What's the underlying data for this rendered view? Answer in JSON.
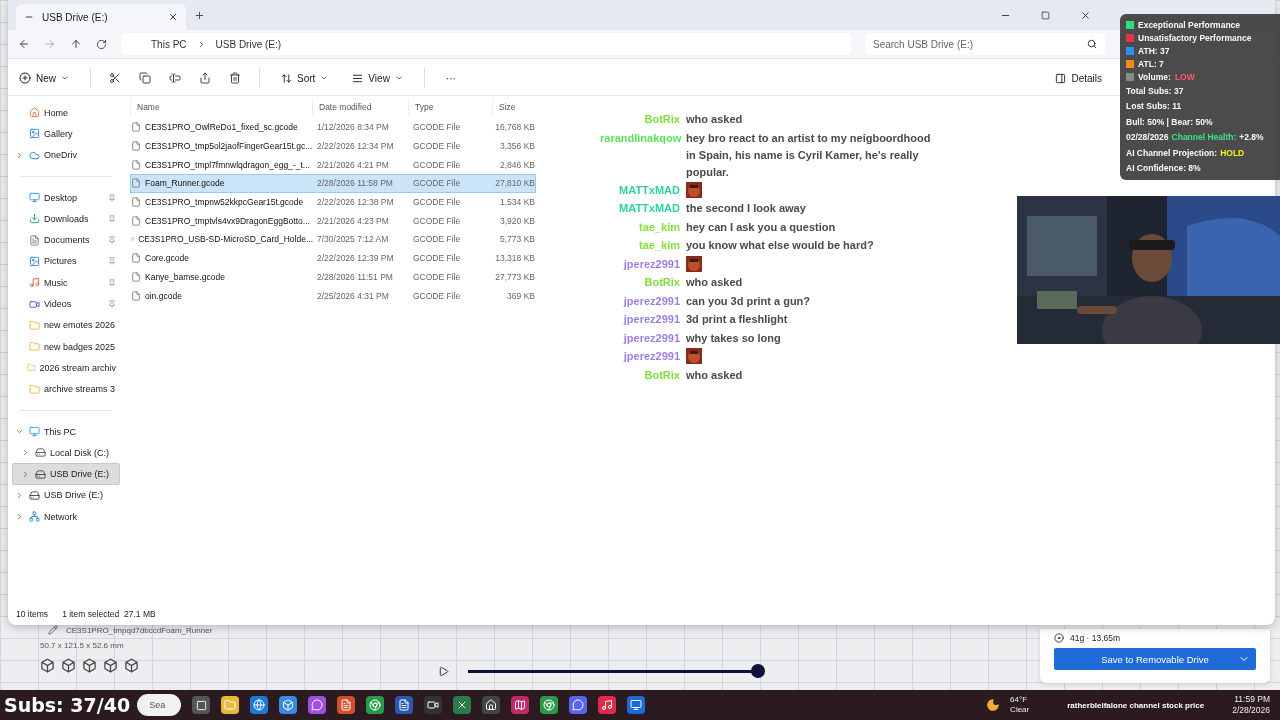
{
  "explorer": {
    "tab_title": "USB Drive (E:)",
    "breadcrumb": [
      "This PC",
      "USB Drive (E:)"
    ],
    "search": {
      "placeholder": "Search USB Drive (E:)"
    },
    "toolbar": {
      "new": "New",
      "sort": "Sort",
      "view": "View",
      "more": "···",
      "details": "Details"
    },
    "sidebar": [
      {
        "items": [
          {
            "label": "Home",
            "selected": false
          },
          {
            "label": "Gallery",
            "selected": false
          },
          {
            "label": "OneDriv",
            "selected": false,
            "expanded": false
          }
        ]
      },
      {
        "items": [
          {
            "label": "Desktop",
            "pinned": true,
            "selected": false
          },
          {
            "label": "Downloads",
            "pinned": true,
            "selected": false
          },
          {
            "label": "Documents",
            "pinned": true,
            "selected": false
          },
          {
            "label": "Pictures",
            "pinned": true,
            "selected": false
          },
          {
            "label": "Music",
            "pinned": true,
            "selected": false
          },
          {
            "label": "Videos",
            "pinned": true,
            "selected": false
          },
          {
            "label": "new emotes 2026",
            "selected": false
          },
          {
            "label": "new badges 2025",
            "selected": false
          },
          {
            "label": "2026 stream archiv",
            "selected": false
          },
          {
            "label": "archive streams 3",
            "selected": false
          }
        ]
      },
      {
        "items": [
          {
            "label": "This PC",
            "selected": false,
            "expanded": true,
            "children": [
              {
                "label": "Local Disk (C:)",
                "selected": false,
                "expanded": false
              },
              {
                "label": "USB Drive (E:)",
                "selected": true,
                "expanded": false
              }
            ]
          },
          {
            "label": "USB Drive (E:)",
            "selected": false,
            "expanded": false
          },
          {
            "label": "Network",
            "selected": false,
            "expanded": false
          }
        ]
      }
    ],
    "columns": [
      "Name",
      "Date modified",
      "Type",
      "Size"
    ],
    "rows": [
      {
        "name": "CE3S1PRO_OwlReDo1_fixed_sc.gcode",
        "date": "1/12/2026 8:34 PM",
        "type": "GCODE File",
        "size": "16,768 KB",
        "selected": false
      },
      {
        "name": "CE3S1PRO_tmp5ol2jaofFingerGear15t.gc...",
        "date": "2/22/2026 12:34 PM",
        "type": "GCODE File",
        "size": "3,356 KB",
        "selected": false
      },
      {
        "name": "CE3S1PRO_tmpl7fmnwlqdragon_egg_-_t...",
        "date": "2/21/2026 4:21 PM",
        "type": "GCODE File",
        "size": "2,846 KB",
        "selected": false
      },
      {
        "name": "Foam_Runner.gcode",
        "date": "2/28/2026 11:58 PM",
        "type": "GCODE File",
        "size": "27,810 KB",
        "selected": true
      },
      {
        "name": "CE3S1PRO_tmpnw52kkpcGear15t.gcode",
        "date": "2/22/2026 12:38 PM",
        "type": "GCODE File",
        "size": "1,534 KB",
        "selected": false
      },
      {
        "name": "CE3S1PRO_tmptvls4vx9DragonEggBotto...",
        "date": "2/21/2026 4:23 PM",
        "type": "GCODE File",
        "size": "3,920 KB",
        "selected": false
      },
      {
        "name": "CE3S1PRO_USB-SD-MicroSD_Card_Holde...",
        "date": "7/30/2025 7:12 AM",
        "type": "GCODE File",
        "size": "5,773 KB",
        "selected": false
      },
      {
        "name": "Core.gcode",
        "date": "2/22/2026 12:39 PM",
        "type": "GCODE File",
        "size": "13,318 KB",
        "selected": false
      },
      {
        "name": "Kanye_bamse.gcode",
        "date": "2/28/2026 11:51 PM",
        "type": "GCODE File",
        "size": "27,773 KB",
        "selected": false
      },
      {
        "name": "oin.gcode",
        "date": "2/25/2026 4:31 PM",
        "type": "GCODE File",
        "size": "369 KB",
        "selected": false
      }
    ],
    "status": {
      "count": "10 items",
      "selection": "1 item selected  27.1 MB"
    }
  },
  "slicer": {
    "object_name": "CE3S1PRO_tmpqd7dbccdFoam_Runner",
    "dimensions": "50.7 x 121.5 x 52.6 mm",
    "estimate": "41g · 13.65m",
    "save_button": "Save to Removable Drive",
    "layer_slider": {
      "level": 1
    }
  },
  "chat": [
    {
      "kind": "message",
      "user": "BotRix",
      "color": "#7fdc3c",
      "message": "who asked"
    },
    {
      "kind": "message",
      "user": "rarandlinakqow",
      "color": "#5de05a",
      "message": "hey bro react to an artist to my neigboordhood in Spain, his name is Cyril Kamer, he's really popular."
    },
    {
      "kind": "emote",
      "user": "MATTxMAD",
      "color": "#2ed39a"
    },
    {
      "kind": "message",
      "user": "MATTxMAD",
      "color": "#2ed39a",
      "message": "the second I look away"
    },
    {
      "kind": "message",
      "user": "tae_kim",
      "color": "#86e03c",
      "message": "hey can I ask you a question"
    },
    {
      "kind": "message",
      "user": "tae_kim",
      "color": "#86e03c",
      "message": "you know what else would be hard?"
    },
    {
      "kind": "emote",
      "user": "jperez2991",
      "color": "#9c7fe2"
    },
    {
      "kind": "message",
      "user": "BotRix",
      "color": "#7fdc3c",
      "message": "who asked"
    },
    {
      "kind": "message",
      "user": "jperez2991",
      "color": "#9c7fe2",
      "message": "can you 3d print a gun?"
    },
    {
      "kind": "message",
      "user": "jperez2991",
      "color": "#9c7fe2",
      "message": "3d print a fleshlight"
    },
    {
      "kind": "message",
      "user": "jperez2991",
      "color": "#9c7fe2",
      "message": "why takes so long"
    },
    {
      "kind": "emote",
      "user": "jperez2991",
      "color": "#9c7fe2"
    },
    {
      "kind": "message",
      "user": "BotRix",
      "color": "#7fdc3c",
      "message": "who asked"
    }
  ],
  "stats": {
    "legend": [
      {
        "color": "#2fe07a",
        "parts": [
          {
            "text": "Exceptional Performance"
          }
        ]
      },
      {
        "color": "#e8334a",
        "parts": [
          {
            "text": "Unsatisfactory Performance"
          }
        ]
      },
      {
        "color": "#2f8ff0",
        "parts": [
          {
            "text": "ATH: 37"
          }
        ]
      },
      {
        "color": "#f08a1c",
        "parts": [
          {
            "text": "ATL: 7"
          }
        ]
      },
      {
        "color": "#8a8a8a",
        "parts": [
          {
            "text": "Volume:"
          },
          {
            "text": "LOW",
            "color": "#ff5a72"
          }
        ]
      }
    ],
    "lines": [
      [
        {
          "text": "Total Subs: 37"
        }
      ],
      [
        {
          "text": "Lost Subs: 11"
        }
      ],
      [
        {
          "text": "Bull: 50% | Bear: 50%"
        }
      ],
      [
        {
          "text": "02/28/2026"
        },
        {
          "text": "Channel Health:",
          "color": "#3ee08a"
        },
        {
          "text": "+2.8%"
        }
      ],
      [
        {
          "text": "AI Channel Projection:"
        },
        {
          "text": "HOLD",
          "color": "#f2f020"
        }
      ],
      [
        {
          "text": "AI Confidence: 8%"
        }
      ]
    ]
  },
  "subs_counter": "Subs: 37/40",
  "taskbar": {
    "search_placeholder": "Sea",
    "weather": {
      "temp": "64°F",
      "condition": "Clear"
    },
    "ticker": "ratherblelfalone channel stock price",
    "time": "11:59 PM",
    "date": "2/28/2026"
  }
}
